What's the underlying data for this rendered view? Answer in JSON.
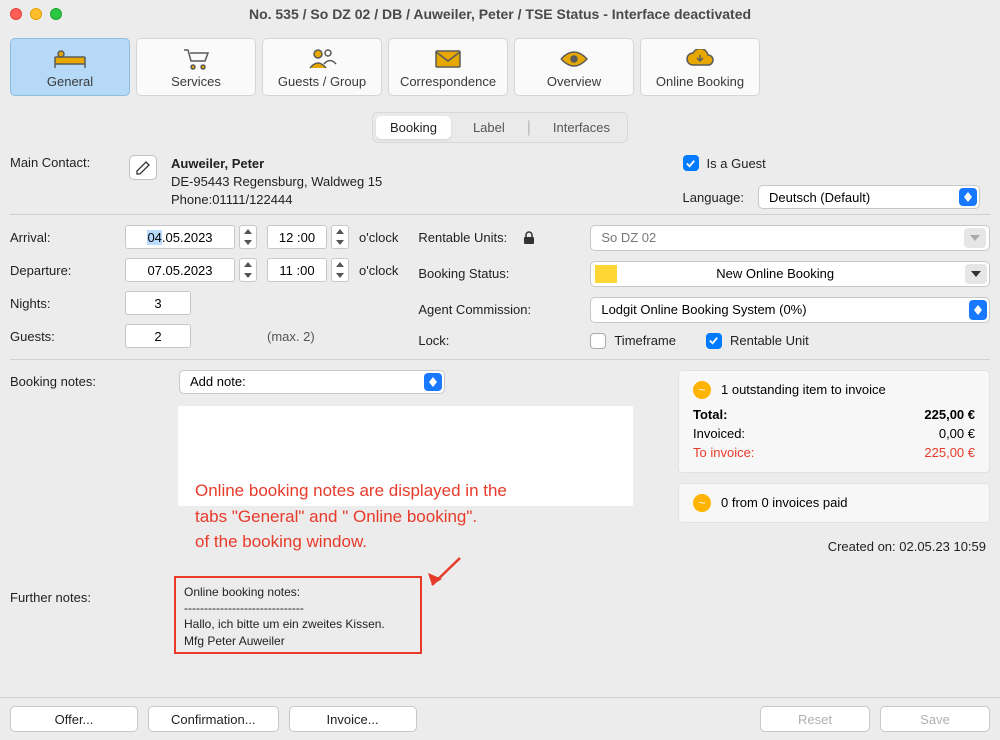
{
  "window": {
    "title": "No. 535 / So DZ 02 / DB / Auweiler, Peter / TSE Status - Interface deactivated"
  },
  "toolbar": {
    "general": "General",
    "services": "Services",
    "guests_group": "Guests / Group",
    "correspondence": "Correspondence",
    "overview": "Overview",
    "online_booking": "Online Booking"
  },
  "subtabs": {
    "booking": "Booking",
    "label": "Label",
    "interfaces": "Interfaces"
  },
  "contact": {
    "label": "Main Contact:",
    "name": "Auweiler, Peter",
    "address": "DE-95443 Regensburg, Waldweg 15",
    "phone": "Phone:01111/122444",
    "is_guest_label": "Is a Guest",
    "language_label": "Language:",
    "language_value": "Deutsch (Default)"
  },
  "dates": {
    "arrival_label": "Arrival:",
    "arrival_date": "04.05.2023",
    "arrival_time": "12 :00",
    "departure_label": "Departure:",
    "departure_date": "07.05.2023",
    "departure_time": "11 :00",
    "oclock": "o'clock",
    "nights_label": "Nights:",
    "nights_value": "3",
    "guests_label": "Guests:",
    "guests_value": "2",
    "guests_max": "(max. 2)"
  },
  "right": {
    "rentable_label": "Rentable Units:",
    "rentable_value": "So DZ 02",
    "status_label": "Booking Status:",
    "status_value": "New Online Booking",
    "agent_label": "Agent Commission:",
    "agent_value": "Lodgit Online Booking System (0%)",
    "lock_label": "Lock:",
    "lock_timeframe": "Timeframe",
    "lock_rentable": "Rentable Unit"
  },
  "notes": {
    "booking_notes_label": "Booking notes:",
    "add_note_label": "Add note:",
    "further_notes_label": "Further notes:",
    "further_heading": "Online booking notes:",
    "further_sep": "------------------------------",
    "further_line1": "Hallo, ich bitte um ein zweites Kissen.",
    "further_line2": "Mfg Peter Auweiler"
  },
  "annotation": {
    "line1": "Online booking notes are displayed in the",
    "line2": "tabs \"General\" and \" Online booking\".",
    "line3": "of the booking window."
  },
  "summary": {
    "outstanding": "1 outstanding item to invoice",
    "total_label": "Total:",
    "total_value": "225,00 €",
    "invoiced_label": "Invoiced:",
    "invoiced_value": "0,00 €",
    "to_invoice_label": "To invoice:",
    "to_invoice_value": "225,00 €",
    "paid": "0 from 0 invoices paid",
    "created": "Created on: 02.05.23 10:59"
  },
  "footer": {
    "offer": "Offer...",
    "confirmation": "Confirmation...",
    "invoice": "Invoice...",
    "reset": "Reset",
    "save": "Save"
  }
}
